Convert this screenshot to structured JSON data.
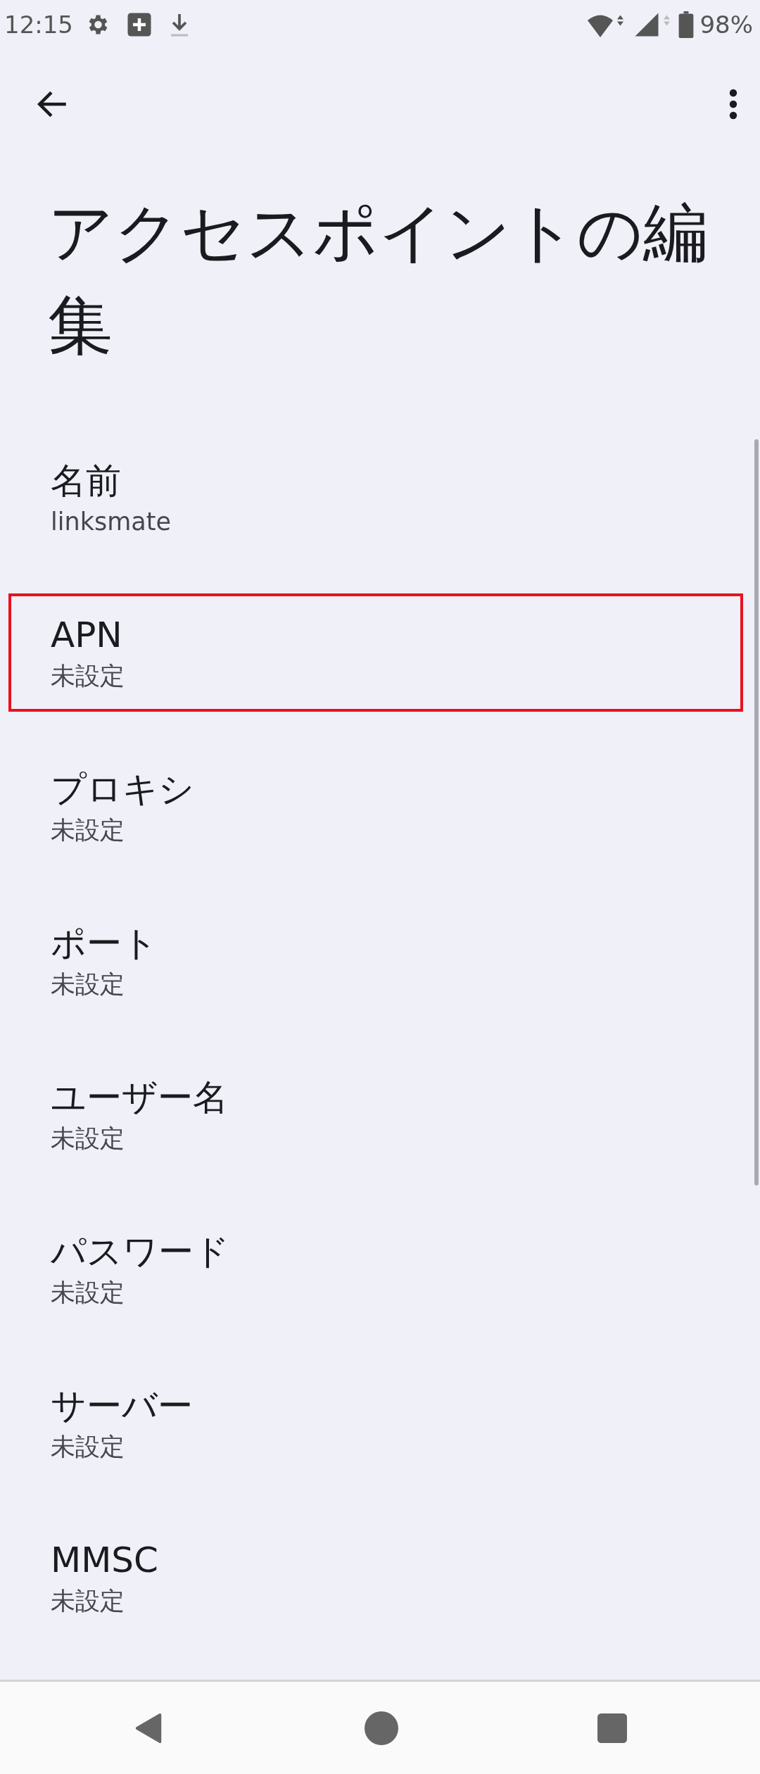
{
  "status_bar": {
    "time": "12:15",
    "battery": "98%"
  },
  "title": "アクセスポイントの編集",
  "settings": [
    {
      "label": "名前",
      "value": "linksmate",
      "highlighted": false
    },
    {
      "label": "APN",
      "value": "未設定",
      "highlighted": true
    },
    {
      "label": "プロキシ",
      "value": "未設定",
      "highlighted": false
    },
    {
      "label": "ポート",
      "value": "未設定",
      "highlighted": false
    },
    {
      "label": "ユーザー名",
      "value": "未設定",
      "highlighted": false
    },
    {
      "label": "パスワード",
      "value": "未設定",
      "highlighted": false
    },
    {
      "label": "サーバー",
      "value": "未設定",
      "highlighted": false
    },
    {
      "label": "MMSC",
      "value": "未設定",
      "highlighted": false
    }
  ]
}
